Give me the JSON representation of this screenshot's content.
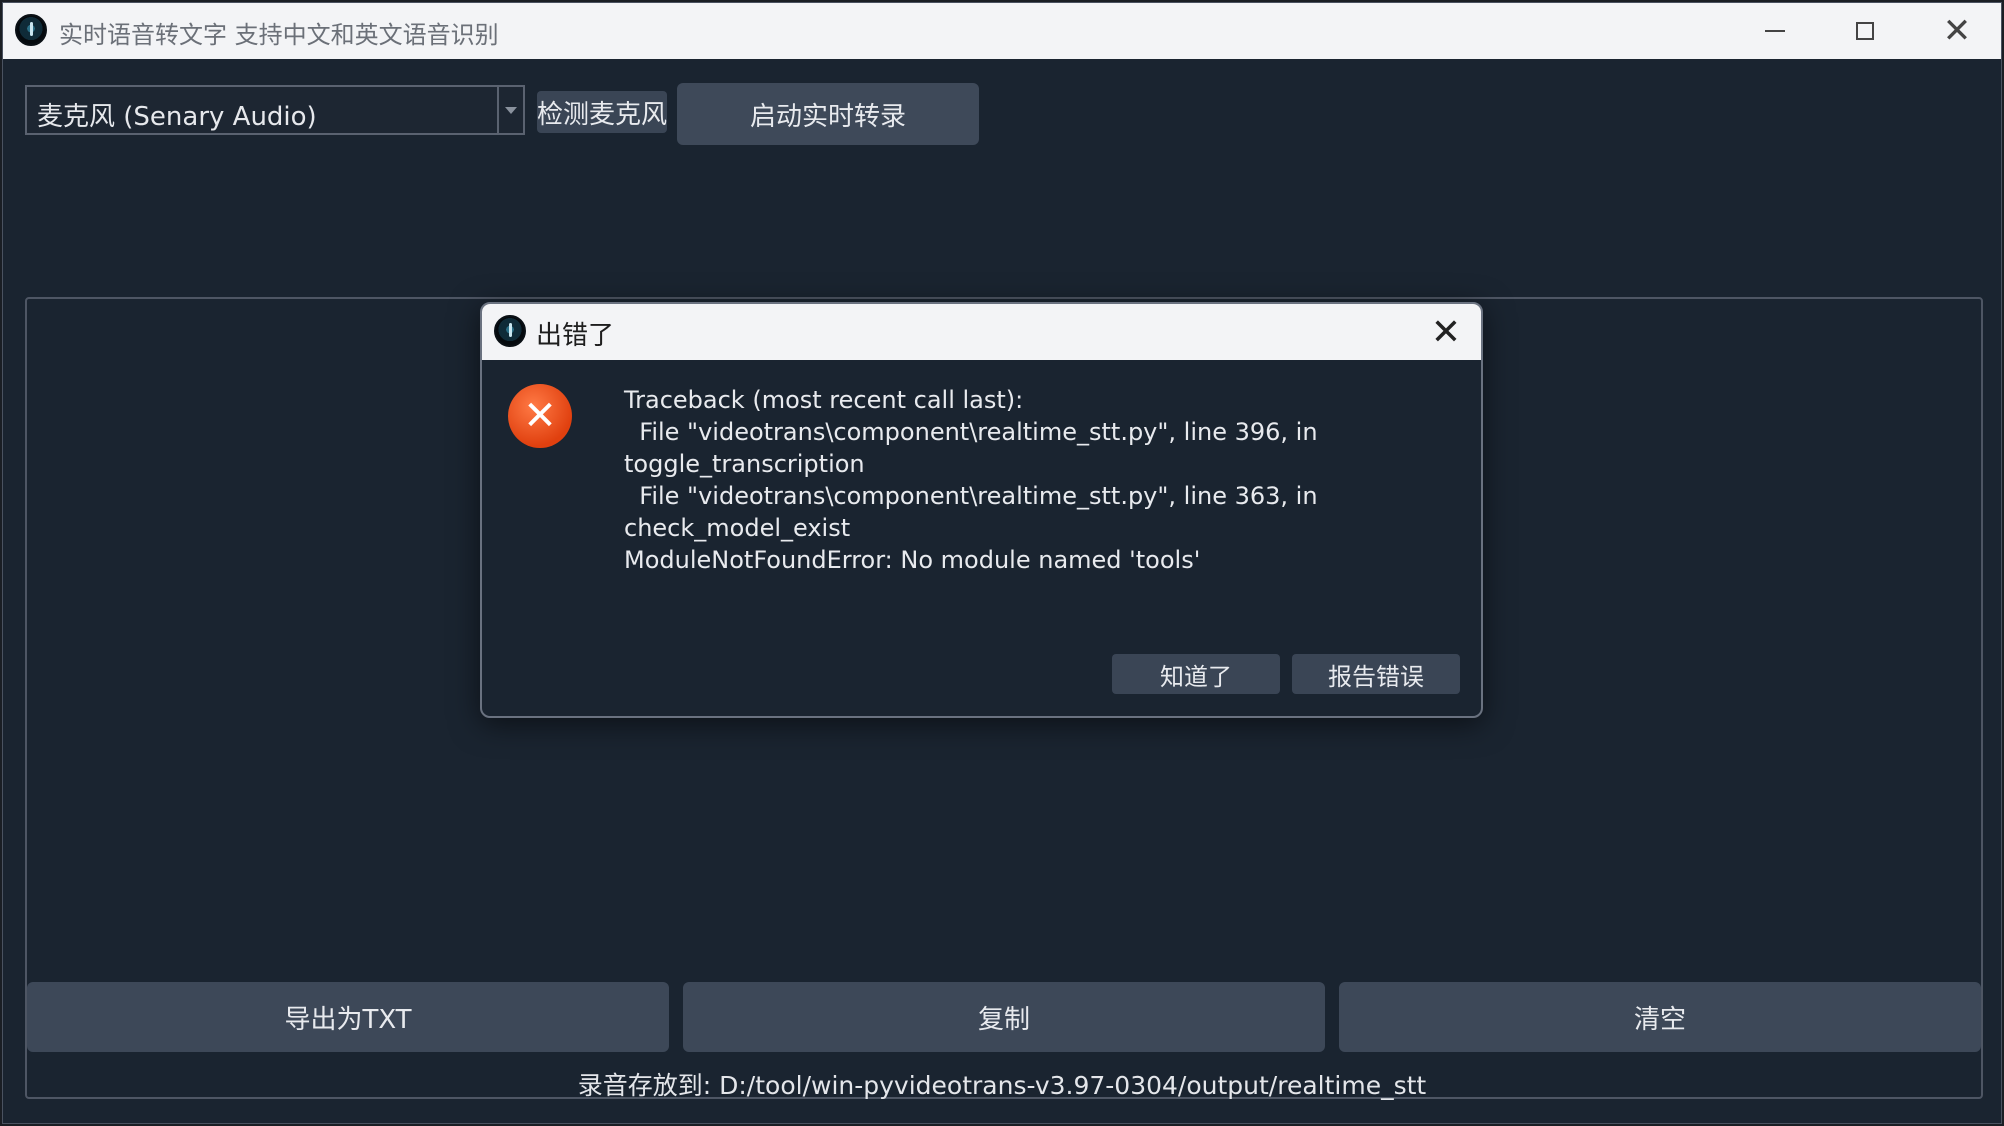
{
  "window": {
    "title": "实时语音转文字 支持中文和英文语音识别"
  },
  "controls": {
    "microphone_selected": "麦克风 (Senary Audio)",
    "detect_button": "检测麦克风",
    "start_button": "启动实时转录"
  },
  "bottom": {
    "export_button": "导出为TXT",
    "copy_button": "复制",
    "clear_button": "清空",
    "save_path": "录音存放到: D:/tool/win-pyvideotrans-v3.97-0304/output/realtime_stt"
  },
  "dialog": {
    "title": "出错了",
    "message_lines": [
      "Traceback (most recent call last):",
      "  File \"videotrans\\component\\realtime_stt.py\", line 396, in",
      "toggle_transcription",
      "  File \"videotrans\\component\\realtime_stt.py\", line 363, in",
      "check_model_exist",
      "ModuleNotFoundError: No module named 'tools'"
    ],
    "ok_button": "知道了",
    "report_button": "报告错误"
  }
}
